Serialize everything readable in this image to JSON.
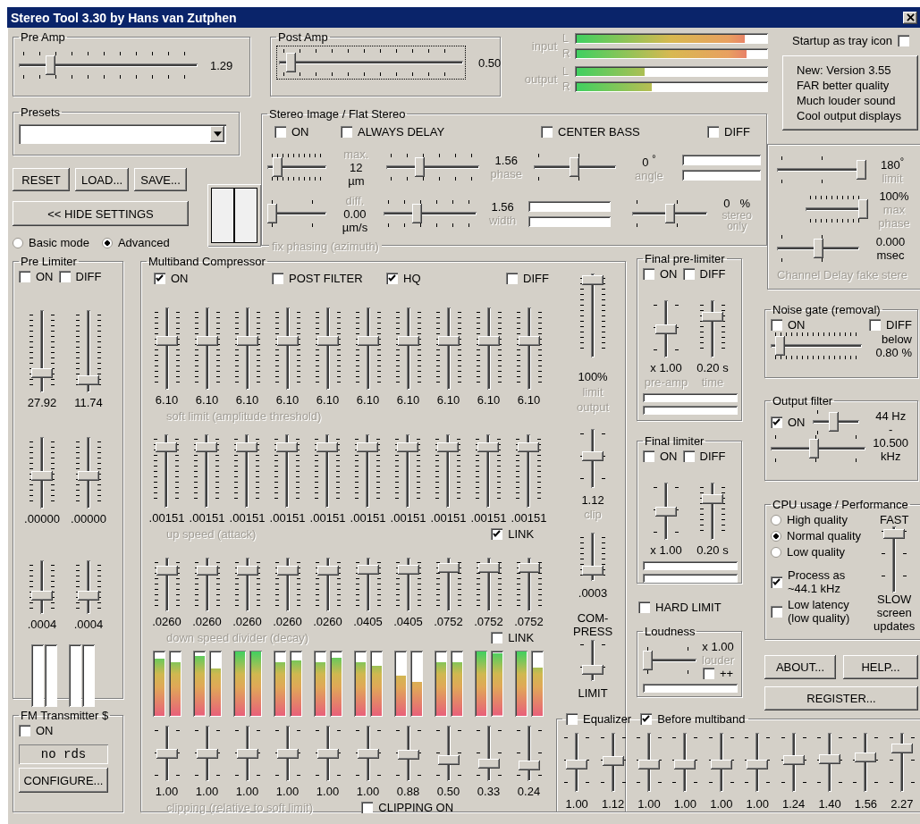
{
  "window": {
    "title": "Stereo Tool 3.30 by Hans van Zutphen"
  },
  "pre_amp": {
    "title": "Pre Amp",
    "level": 0.16,
    "reading": "1.29"
  },
  "post_amp": {
    "title": "Post Amp",
    "level": 0.04,
    "reading": "0.50",
    "focused": true
  },
  "meters": [
    {
      "label": "input",
      "channels": [
        {
          "name": "L",
          "level": 0.87
        },
        {
          "name": "R",
          "level": 0.88
        }
      ]
    },
    {
      "label": "output",
      "channels": [
        {
          "name": "L",
          "level": 0.35
        },
        {
          "name": "R",
          "level": 0.39
        }
      ]
    }
  ],
  "tray": {
    "label": "Startup as tray icon",
    "checked": false
  },
  "news": [
    "New: Version 3.55",
    "FAR better quality",
    "Much louder sound",
    "Cool output displays"
  ],
  "presets": {
    "title": "Presets"
  },
  "file_buttons": [
    "RESET",
    "LOAD...",
    "SAVE..."
  ],
  "hide_settings": "<< HIDE SETTINGS",
  "modes": [
    {
      "label": "Basic mode",
      "selected": false
    },
    {
      "label": "Advanced",
      "selected": true
    }
  ],
  "stereo_image": {
    "title": "Stereo Image / Flat Stereo",
    "checks": [
      {
        "label": "ON",
        "checked": false
      },
      {
        "label": "ALWAYS DELAY",
        "checked": false
      },
      {
        "label": "CENTER BASS",
        "checked": false
      },
      {
        "label": "DIFF",
        "checked": false
      }
    ],
    "max": {
      "label": "max.",
      "value": "12",
      "unit": "µm",
      "level": 0.1
    },
    "diff": {
      "label": "diff.",
      "value": "0.00",
      "unit": "µm/s",
      "level": 0
    },
    "caption": "fix phasing (azimuth)",
    "phase": {
      "value": "1.56",
      "label": "phase",
      "level": 0.35
    },
    "width": {
      "value": "1.56",
      "label": "width",
      "level": 0.35
    },
    "angle": {
      "value": "0",
      "unit": "°",
      "label": "angle",
      "level": 0.5
    },
    "angle_meters": [
      {
        "level": 0
      },
      {
        "level": 0
      }
    ],
    "width_meters": [
      {
        "level": 0
      },
      {
        "level": 0
      }
    ],
    "stereo_only": {
      "value": "0",
      "unit": "%",
      "label": "stereo only",
      "level": 0.5
    }
  },
  "channel_delay": {
    "limit": {
      "value": "180",
      "unit": "°",
      "label": "limit",
      "level": 1
    },
    "max_phase": {
      "value": "100%",
      "label": "max phase",
      "level": 1
    },
    "delay": {
      "value": "0.000",
      "unit": "msec",
      "level": 0.5
    },
    "caption": "Channel Delay fake stere"
  },
  "pre_limiter": {
    "title": "Pre Limiter",
    "checks": [
      {
        "label": "ON",
        "checked": false
      },
      {
        "label": "DIFF",
        "checked": false
      }
    ],
    "rows": [
      {
        "sliders": [
          {
            "level": 0.2,
            "value": "27.92"
          },
          {
            "level": 0.1,
            "value": "11.74"
          }
        ]
      },
      {
        "sliders": [
          {
            "level": 0.45,
            "value": ".00000"
          },
          {
            "level": 0.45,
            "value": ".00000"
          }
        ]
      },
      {
        "sliders": [
          {
            "level": 0.3,
            "value": ".0004"
          },
          {
            "level": 0.3,
            "value": ".0004"
          }
        ]
      }
    ],
    "meters": [
      {
        "level": 0
      },
      {
        "level": 0
      },
      {
        "level": 0
      },
      {
        "level": 0
      }
    ]
  },
  "fm": {
    "title": "FM Transmitter $",
    "on": {
      "label": "ON",
      "checked": false
    },
    "rds": "no rds",
    "button": "CONFIGURE..."
  },
  "multiband": {
    "title": "Multiband Compressor",
    "checks": [
      {
        "label": "ON",
        "checked": true
      },
      {
        "label": "POST FILTER",
        "checked": false
      },
      {
        "label": "HQ",
        "checked": true
      },
      {
        "label": "DIFF",
        "checked": false
      }
    ],
    "rows": [
      {
        "caption": "soft limit (amplitude threshold)",
        "sliders": [
          {
            "level": 0.6,
            "value": "6.10"
          },
          {
            "level": 0.6,
            "value": "6.10"
          },
          {
            "level": 0.6,
            "value": "6.10"
          },
          {
            "level": 0.6,
            "value": "6.10"
          },
          {
            "level": 0.6,
            "value": "6.10"
          },
          {
            "level": 0.6,
            "value": "6.10"
          },
          {
            "level": 0.6,
            "value": "6.10"
          },
          {
            "level": 0.6,
            "value": "6.10"
          },
          {
            "level": 0.6,
            "value": "6.10"
          },
          {
            "level": 0.6,
            "value": "6.10"
          }
        ]
      },
      {
        "caption": "up speed (attack)",
        "link": {
          "label": "LINK",
          "checked": true
        },
        "sliders": [
          {
            "level": 0.88,
            "value": ".00151"
          },
          {
            "level": 0.88,
            "value": ".00151"
          },
          {
            "level": 0.88,
            "value": ".00151"
          },
          {
            "level": 0.88,
            "value": ".00151"
          },
          {
            "level": 0.88,
            "value": ".00151"
          },
          {
            "level": 0.88,
            "value": ".00151"
          },
          {
            "level": 0.88,
            "value": ".00151"
          },
          {
            "level": 0.88,
            "value": ".00151"
          },
          {
            "level": 0.88,
            "value": ".00151"
          },
          {
            "level": 0.88,
            "value": ".00151"
          }
        ]
      },
      {
        "caption": "down speed divider (decay)",
        "link": {
          "label": "LINK",
          "checked": false
        },
        "sliders": [
          {
            "level": 0.82,
            "value": ".0260"
          },
          {
            "level": 0.82,
            "value": ".0260"
          },
          {
            "level": 0.82,
            "value": ".0260"
          },
          {
            "level": 0.82,
            "value": ".0260"
          },
          {
            "level": 0.82,
            "value": ".0260"
          },
          {
            "level": 0.84,
            "value": ".0405"
          },
          {
            "level": 0.84,
            "value": ".0405"
          },
          {
            "level": 0.88,
            "value": ".0752"
          },
          {
            "level": 0.88,
            "value": ".0752"
          },
          {
            "level": 0.88,
            "value": ".0752"
          }
        ]
      }
    ],
    "bands": [
      {
        "channels": [
          {
            "level": 0.87
          },
          {
            "level": 0.81
          }
        ]
      },
      {
        "channels": [
          {
            "level": 0.9
          },
          {
            "level": 0.72
          }
        ]
      },
      {
        "channels": [
          {
            "level": 1
          },
          {
            "level": 1
          }
        ]
      },
      {
        "channels": [
          {
            "level": 0.81
          },
          {
            "level": 0.84
          }
        ]
      },
      {
        "channels": [
          {
            "level": 0.81
          },
          {
            "level": 0.88
          }
        ]
      },
      {
        "channels": [
          {
            "level": 0.81
          },
          {
            "level": 0.76
          }
        ]
      },
      {
        "channels": [
          {
            "level": 0.61
          },
          {
            "level": 0.52
          }
        ]
      },
      {
        "channels": [
          {
            "level": 0.81
          },
          {
            "level": 0.81
          }
        ]
      },
      {
        "channels": [
          {
            "level": 1
          },
          {
            "level": 0.94
          }
        ]
      },
      {
        "channels": [
          {
            "level": 1
          },
          {
            "level": 0.73
          }
        ]
      }
    ],
    "clipping": {
      "caption": "clipping (relative to soft limit)",
      "check": {
        "label": "CLIPPING ON",
        "checked": false
      },
      "sliders": [
        {
          "level": 0.5,
          "value": "1.00"
        },
        {
          "level": 0.5,
          "value": "1.00"
        },
        {
          "level": 0.5,
          "value": "1.00"
        },
        {
          "level": 0.5,
          "value": "1.00"
        },
        {
          "level": 0.5,
          "value": "1.00"
        },
        {
          "level": 0.5,
          "value": "1.00"
        },
        {
          "level": 0.47,
          "value": "0.88"
        },
        {
          "level": 0.35,
          "value": "0.50"
        },
        {
          "level": 0.28,
          "value": "0.33"
        },
        {
          "level": 0.24,
          "value": "0.24"
        }
      ]
    },
    "output_limit": {
      "value": "100%",
      "label": "limit output",
      "level": 0.98
    },
    "clip": {
      "value": "1.12",
      "label": "clip",
      "level": 0.55
    },
    "release": {
      "value": ".0003",
      "level": 0.15
    },
    "mode": {
      "top": "COM-\nPRESS",
      "bottom": "LIMIT",
      "level": 0.2
    }
  },
  "final_pre_limiter": {
    "title": "Final pre-limiter",
    "checks": [
      {
        "label": "ON",
        "checked": false
      },
      {
        "label": "DIFF",
        "checked": false
      }
    ],
    "sliders": [
      {
        "value": "x 1.00",
        "label": "pre-amp",
        "level": 0.5
      },
      {
        "value": "0.20 s",
        "label": "time",
        "level": 0.75
      }
    ],
    "meters": [
      {
        "level": 0
      },
      {
        "level": 0
      }
    ]
  },
  "final_limiter": {
    "title": "Final limiter",
    "checks": [
      {
        "label": "ON",
        "checked": false
      },
      {
        "label": "DIFF",
        "checked": false
      }
    ],
    "sliders": [
      {
        "value": "x 1.00",
        "level": 0.5
      },
      {
        "value": "0.20 s",
        "level": 0.75
      }
    ],
    "meters": [
      {
        "level": 0
      },
      {
        "level": 0
      }
    ]
  },
  "hard_limit": {
    "label": "HARD LIMIT",
    "checked": false
  },
  "loudness": {
    "title": "Loudness",
    "value": "x 1.00",
    "label": "louder",
    "level": 0,
    "plus": {
      "label": "++",
      "checked": false
    },
    "meter": {
      "level": 0
    }
  },
  "noise_gate": {
    "title": "Noise gate (removal)",
    "checks": [
      {
        "label": "ON",
        "checked": false
      },
      {
        "label": "DIFF",
        "checked": false
      }
    ],
    "level": 0.05,
    "label": "below",
    "value": "0.80 %"
  },
  "output_filter": {
    "title": "Output filter",
    "on": {
      "label": "ON",
      "checked": true
    },
    "low": {
      "level": 0.45,
      "value": "44 Hz"
    },
    "separator": "-",
    "high": {
      "level": 0.45,
      "value": "10.500 kHz"
    }
  },
  "cpu": {
    "title": "CPU usage / Performance",
    "qualities": [
      {
        "label": "High quality",
        "selected": false
      },
      {
        "label": "Normal quality",
        "selected": true
      },
      {
        "label": "Low quality",
        "selected": false
      }
    ],
    "process": {
      "label": "Process as\n~44.1 kHz",
      "checked": true
    },
    "latency": {
      "label": "Low latency\n(low quality)",
      "checked": false
    },
    "fast": "FAST",
    "slow": "SLOW",
    "updates": "screen updates",
    "level": 0.95
  },
  "about": "ABOUT...",
  "help": "HELP...",
  "register": "REGISTER...",
  "equalizer": {
    "on": {
      "label": "Equalizer",
      "checked": false
    },
    "before": {
      "label": "Before multiband",
      "checked": true
    },
    "bands": [
      {
        "level": 0.45,
        "value": "1.00"
      },
      {
        "level": 0.52,
        "value": "1.12"
      },
      {
        "level": 0.45,
        "value": "1.00"
      },
      {
        "level": 0.45,
        "value": "1.00"
      },
      {
        "level": 0.45,
        "value": "1.00"
      },
      {
        "level": 0.45,
        "value": "1.00"
      },
      {
        "level": 0.55,
        "value": "1.24"
      },
      {
        "level": 0.57,
        "value": "1.40"
      },
      {
        "level": 0.6,
        "value": "1.56"
      },
      {
        "level": 0.78,
        "value": "2.27"
      }
    ]
  }
}
